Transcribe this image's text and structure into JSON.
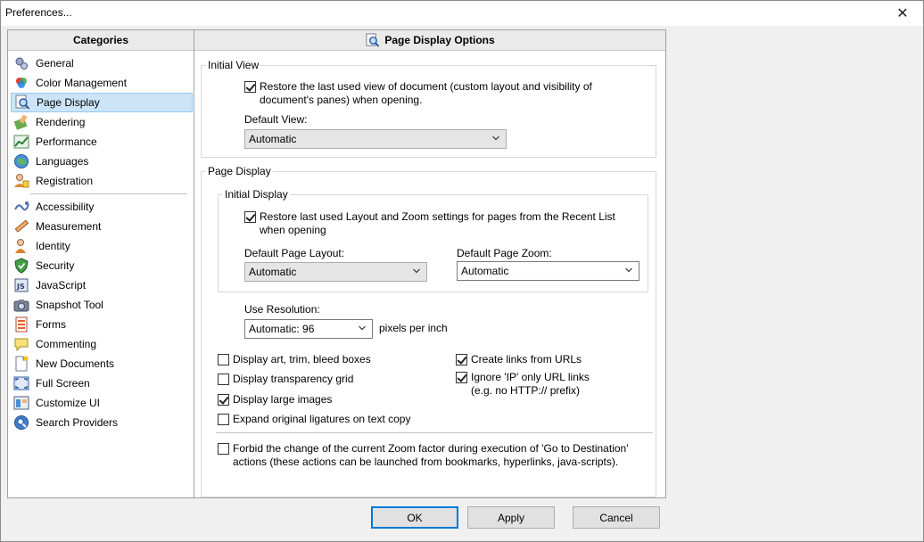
{
  "window": {
    "title": "Preferences...",
    "close_glyph": "✕"
  },
  "categories": {
    "header": "Categories",
    "items": [
      {
        "label": "General",
        "icon": "general-icon"
      },
      {
        "label": "Color Management",
        "icon": "color-management-icon"
      },
      {
        "label": "Page Display",
        "icon": "page-display-icon",
        "selected": true
      },
      {
        "label": "Rendering",
        "icon": "rendering-icon"
      },
      {
        "label": "Performance",
        "icon": "performance-icon"
      },
      {
        "label": "Languages",
        "icon": "languages-icon"
      },
      {
        "label": "Registration",
        "icon": "registration-icon"
      },
      {
        "label": "Accessibility",
        "icon": "accessibility-icon"
      },
      {
        "label": "Measurement",
        "icon": "measurement-icon"
      },
      {
        "label": "Identity",
        "icon": "identity-icon"
      },
      {
        "label": "Security",
        "icon": "security-icon"
      },
      {
        "label": "JavaScript",
        "icon": "javascript-icon"
      },
      {
        "label": "Snapshot Tool",
        "icon": "snapshot-tool-icon"
      },
      {
        "label": "Forms",
        "icon": "forms-icon"
      },
      {
        "label": "Commenting",
        "icon": "commenting-icon"
      },
      {
        "label": "New Documents",
        "icon": "new-documents-icon"
      },
      {
        "label": "Full Screen",
        "icon": "full-screen-icon"
      },
      {
        "label": "Customize UI",
        "icon": "customize-ui-icon"
      },
      {
        "label": "Search Providers",
        "icon": "search-providers-icon"
      }
    ]
  },
  "options": {
    "header": "Page Display Options",
    "initial_view": {
      "title": "Initial View",
      "restore_view_label": "Restore the last used view of document (custom layout and visibility of document's panes) when opening.",
      "restore_view_checked": true,
      "default_view_label": "Default View:",
      "default_view_value": "Automatic"
    },
    "page_display": {
      "title": "Page Display",
      "initial_display": {
        "title": "Initial Display",
        "restore_layout_label": "Restore last used Layout and Zoom settings for pages from the Recent List when opening",
        "restore_layout_checked": true,
        "layout_label": "Default Page Layout:",
        "layout_value": "Automatic",
        "zoom_label": "Default Page Zoom:",
        "zoom_value": "Automatic"
      },
      "resolution_label": "Use Resolution:",
      "resolution_value": "Automatic: 96",
      "resolution_unit": "pixels per inch",
      "display_boxes_label": "Display art, trim, bleed boxes",
      "display_boxes_checked": false,
      "transparency_grid_label": "Display transparency grid",
      "transparency_grid_checked": false,
      "large_images_label": "Display large images",
      "large_images_checked": true,
      "ligatures_label": "Expand original ligatures on text copy",
      "ligatures_checked": false,
      "create_links_label": "Create links from URLs",
      "create_links_checked": true,
      "ignore_ip_label": "Ignore 'IP' only URL links",
      "ignore_ip_note": "(e.g. no HTTP:// prefix)",
      "ignore_ip_checked": true,
      "forbid_zoom_label": "Forbid the change of the current Zoom factor during execution of 'Go to Destination' actions (these actions can be launched from bookmarks, hyperlinks, java-scripts).",
      "forbid_zoom_checked": false
    }
  },
  "buttons": {
    "ok": "OK",
    "apply": "Apply",
    "cancel": "Cancel"
  },
  "colors": {
    "selection_bg": "#cce4f7",
    "selection_border": "#99c9ef",
    "default_button_border": "#0078d7"
  }
}
